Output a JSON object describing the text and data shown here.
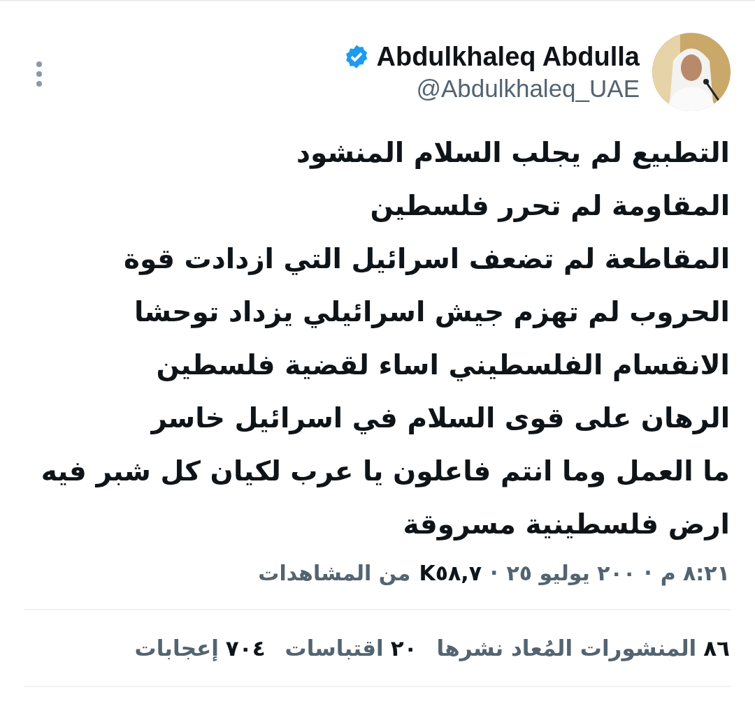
{
  "author": {
    "name": "Abdulkhaleq Abdulla",
    "verified": true,
    "handle": "@Abdulkhaleq_UAE"
  },
  "body_lines": [
    "التطبيع لم يجلب السلام المنشود",
    "المقاومة لم تحرر فلسطين",
    "المقاطعة لم تضعف اسرائيل التي ازدادت قوة",
    "الحروب لم تهزم جيش اسرائيلي يزداد توحشا",
    "الانقسام الفلسطيني اساء لقضية فلسطين",
    "الرهان على قوى السلام في اسرائيل خاسر",
    "ما العمل وما انتم فاعلون يا عرب لكيان كل شبر فيه",
    "ارض فلسطينية مسروقة"
  ],
  "meta": {
    "time": "٨:٢١ م",
    "separator_1": "·",
    "date": "٢٠٠ يوليو ٢٥",
    "separator_2": "·",
    "views_count": "K٥٨,٧",
    "views_label": "من المشاهدات"
  },
  "stats": [
    {
      "count": "٨٦",
      "label": "المنشورات المُعاد نشرها"
    },
    {
      "count": "٢٠",
      "label": "اقتباسات"
    },
    {
      "count": "٧٠٤",
      "label": "إعجابات"
    }
  ]
}
